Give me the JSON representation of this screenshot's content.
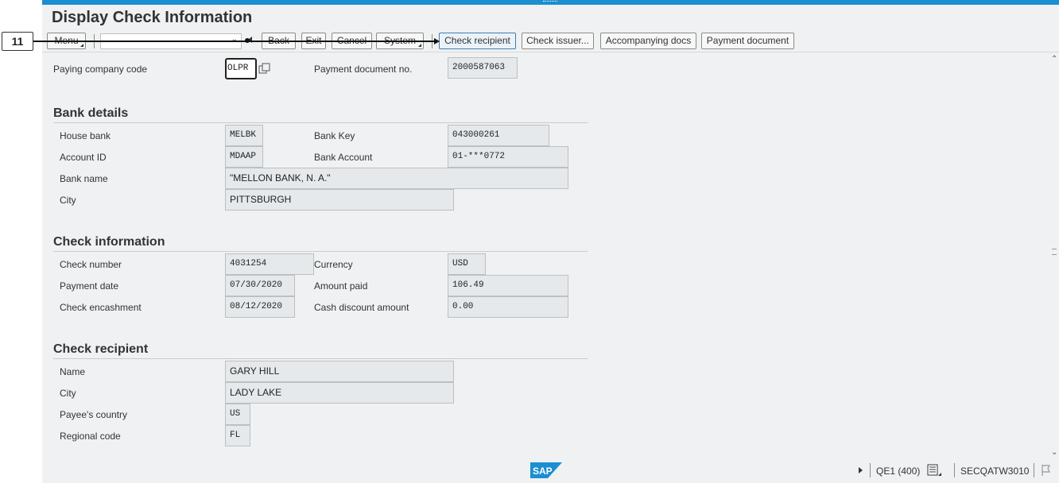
{
  "window": {
    "title": "Display Check Information"
  },
  "toolbar": {
    "menu_label": "Menu",
    "command_value": "",
    "back_label": "Back",
    "exit_label": "Exit",
    "cancel_label": "Cancel",
    "system_label": "System",
    "check_recipient_label": "Check recipient",
    "check_issuer_label": "Check issuer...",
    "accompanying_docs_label": "Accompanying docs",
    "payment_document_label": "Payment document"
  },
  "callout": {
    "number": "11"
  },
  "header_fields": {
    "paying_company_code_label": "Paying company code",
    "paying_company_code_value": "OLPR",
    "payment_document_no_label": "Payment document no.",
    "payment_document_no_value": "2000587063"
  },
  "bank_details": {
    "title": "Bank details",
    "house_bank_label": "House bank",
    "house_bank_value": "MELBK",
    "bank_key_label": "Bank Key",
    "bank_key_value": "043000261",
    "account_id_label": "Account ID",
    "account_id_value": "MDAAP",
    "bank_account_label": "Bank Account",
    "bank_account_value": "01-***0772",
    "bank_name_label": "Bank name",
    "bank_name_value": "\"MELLON BANK, N. A.\"",
    "city_label": "City",
    "city_value": "PITTSBURGH"
  },
  "check_information": {
    "title": "Check information",
    "check_number_label": "Check number",
    "check_number_value": "4031254",
    "currency_label": "Currency",
    "currency_value": "USD",
    "payment_date_label": "Payment date",
    "payment_date_value": "07/30/2020",
    "amount_paid_label": "Amount paid",
    "amount_paid_value": "106.49",
    "check_encashment_label": "Check encashment",
    "check_encashment_value": "08/12/2020",
    "cash_discount_label": "Cash discount amount",
    "cash_discount_value": "0.00"
  },
  "check_recipient": {
    "title": "Check recipient",
    "name_label": "Name",
    "name_value": "GARY HILL",
    "city_label": "City",
    "city_value": "LADY LAKE",
    "payee_country_label": "Payee's country",
    "payee_country_value": "US",
    "regional_code_label": "Regional code",
    "regional_code_value": "FL"
  },
  "status_bar": {
    "logo_text": "SAP",
    "system": "QE1 (400)",
    "server": "SECQATW3010"
  },
  "colors": {
    "accent_bar": "#1b8ed1",
    "background": "#eff1f2",
    "field_background": "#e5e9ec",
    "sap_logo": "#1b8ed1"
  }
}
